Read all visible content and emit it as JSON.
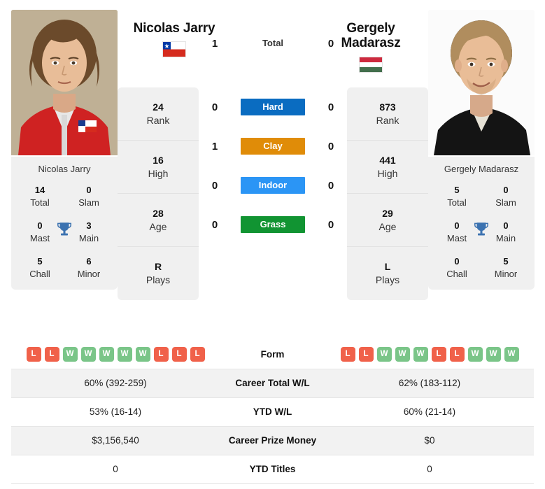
{
  "players": {
    "left": {
      "name": "Nicolas Jarry",
      "first_name": "Nicolas",
      "last_name": "Jarry",
      "country": "Chile",
      "flag_icon": "flag-chile",
      "card_name": "Nicolas Jarry",
      "inner_stats": [
        {
          "value": "24",
          "label": "Rank"
        },
        {
          "value": "16",
          "label": "High"
        },
        {
          "value": "28",
          "label": "Age"
        },
        {
          "value": "R",
          "label": "Plays"
        }
      ],
      "titles": [
        {
          "value": "14",
          "label": "Total"
        },
        {
          "value": "0",
          "label": "Slam"
        },
        {
          "value": "0",
          "label": "Mast"
        },
        {
          "value": "3",
          "label": "Main"
        },
        {
          "value": "5",
          "label": "Chall"
        },
        {
          "value": "6",
          "label": "Minor"
        }
      ],
      "form": [
        "L",
        "L",
        "W",
        "W",
        "W",
        "W",
        "W",
        "L",
        "L",
        "L"
      ],
      "career_total_wl": "60% (392-259)",
      "ytd_wl": "53% (16-14)",
      "career_prize_money": "$3,156,540",
      "ytd_titles": "0"
    },
    "right": {
      "name": "Gergely Madarasz",
      "first_name": "Gergely",
      "last_name": "Madarasz",
      "country": "Hungary",
      "flag_icon": "flag-hungary",
      "card_name": "Gergely Madarasz",
      "inner_stats": [
        {
          "value": "873",
          "label": "Rank"
        },
        {
          "value": "441",
          "label": "High"
        },
        {
          "value": "29",
          "label": "Age"
        },
        {
          "value": "L",
          "label": "Plays"
        }
      ],
      "titles": [
        {
          "value": "5",
          "label": "Total"
        },
        {
          "value": "0",
          "label": "Slam"
        },
        {
          "value": "0",
          "label": "Mast"
        },
        {
          "value": "0",
          "label": "Main"
        },
        {
          "value": "0",
          "label": "Chall"
        },
        {
          "value": "5",
          "label": "Minor"
        }
      ],
      "form": [
        "L",
        "L",
        "W",
        "W",
        "W",
        "L",
        "L",
        "W",
        "W",
        "W"
      ],
      "career_total_wl": "62% (183-112)",
      "ytd_wl": "60% (21-14)",
      "career_prize_money": "$0",
      "ytd_titles": "0"
    }
  },
  "head_to_head": {
    "total": {
      "label": "Total",
      "left": "1",
      "right": "0",
      "color": "transparent"
    },
    "surfaces": [
      {
        "label": "Hard",
        "left": "0",
        "right": "0",
        "color": "#0a6cc1"
      },
      {
        "label": "Clay",
        "left": "1",
        "right": "0",
        "color": "#e08c08"
      },
      {
        "label": "Indoor",
        "left": "0",
        "right": "0",
        "color": "#2b95f5"
      },
      {
        "label": "Grass",
        "left": "0",
        "right": "0",
        "color": "#119432"
      }
    ]
  },
  "stats_table": {
    "rows": [
      {
        "label": "Form",
        "left": "",
        "right": "",
        "type": "form"
      },
      {
        "label": "Career Total W/L",
        "left": "60% (392-259)",
        "right": "62% (183-112)",
        "type": "text"
      },
      {
        "label": "YTD W/L",
        "left": "53% (16-14)",
        "right": "60% (21-14)",
        "type": "text"
      },
      {
        "label": "Career Prize Money",
        "left": "$3,156,540",
        "right": "$0",
        "type": "text"
      },
      {
        "label": "YTD Titles",
        "left": "0",
        "right": "0",
        "type": "text"
      }
    ]
  },
  "colors": {
    "hard": "#0a6cc1",
    "clay": "#e08c08",
    "indoor": "#2b95f5",
    "grass": "#119432",
    "win_badge": "#7ac588",
    "loss_badge": "#f0614a",
    "trophy": "#3b72b0",
    "card_bg": "#f0f0f0"
  }
}
